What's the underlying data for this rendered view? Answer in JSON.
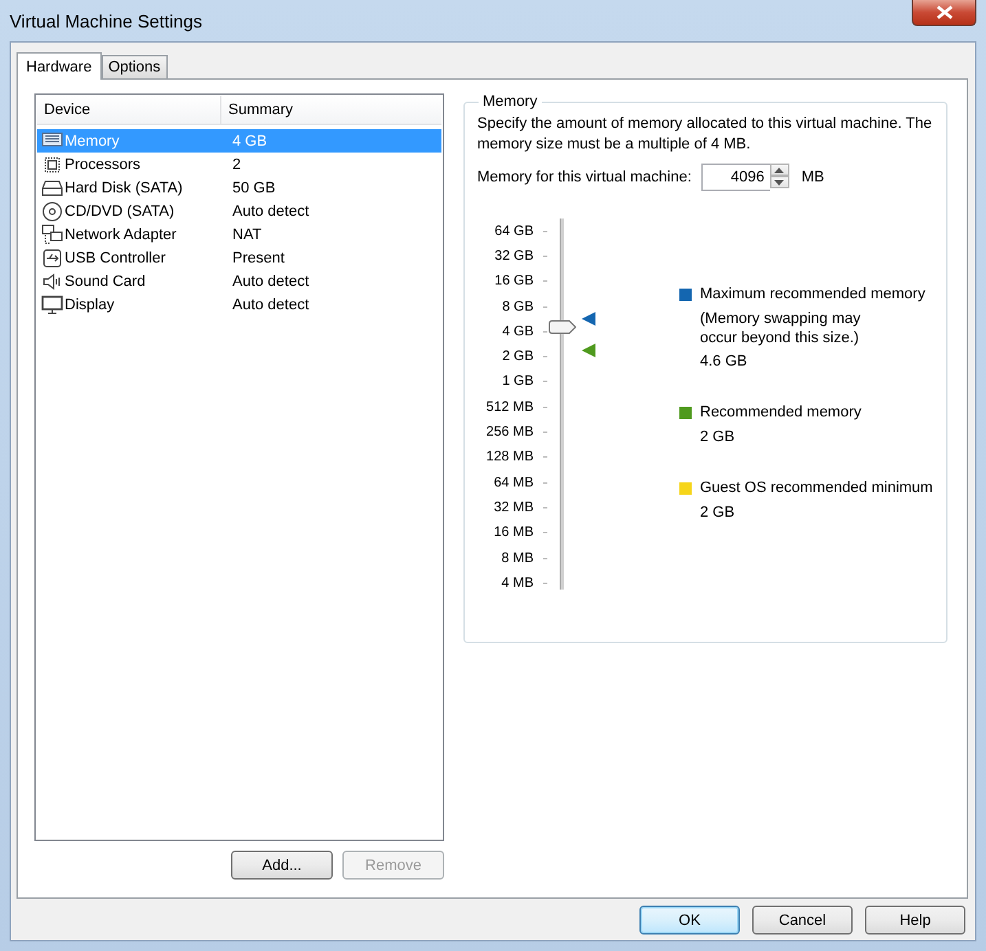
{
  "window": {
    "title": "Virtual Machine Settings"
  },
  "tabs": [
    {
      "label": "Hardware",
      "selected": true
    },
    {
      "label": "Options",
      "selected": false
    }
  ],
  "device_list": {
    "columns": [
      "Device",
      "Summary"
    ],
    "rows": [
      {
        "device": "Memory",
        "summary": "4 GB",
        "selected": true
      },
      {
        "device": "Processors",
        "summary": "2",
        "selected": false
      },
      {
        "device": "Hard Disk (SATA)",
        "summary": "50 GB",
        "selected": false
      },
      {
        "device": "CD/DVD (SATA)",
        "summary": "Auto detect",
        "selected": false
      },
      {
        "device": "Network Adapter",
        "summary": "NAT",
        "selected": false
      },
      {
        "device": "USB Controller",
        "summary": "Present",
        "selected": false
      },
      {
        "device": "Sound Card",
        "summary": "Auto detect",
        "selected": false
      },
      {
        "device": "Display",
        "summary": "Auto detect",
        "selected": false
      }
    ]
  },
  "list_buttons": [
    {
      "label": "Add...",
      "disabled": false
    },
    {
      "label": "Remove",
      "disabled": true
    }
  ],
  "memory": {
    "title": "Memory",
    "description": "Specify the amount of memory allocated to this virtual machine. The memory size must be a multiple of 4 MB.",
    "field_label": "Memory for this virtual machine:",
    "value": "4096",
    "unit": "MB",
    "slider": {
      "ticks": [
        "64 GB",
        "32 GB",
        "16 GB",
        "8 GB",
        "4 GB",
        "2 GB",
        "1 GB",
        "512 MB",
        "256 MB",
        "128 MB",
        "64 MB",
        "32 MB",
        "16 MB",
        "8 MB",
        "4 MB"
      ],
      "level": 0.714,
      "markers": [
        {
          "color": "#1466b0",
          "level": 0.729
        },
        {
          "color": "#4f9a1e",
          "level": 0.643
        }
      ]
    },
    "legend": [
      {
        "label": "Maximum recommended memory",
        "note": "(Memory swapping may occur beyond this size.)",
        "value": "4.6 GB",
        "color": "#1466b0"
      },
      {
        "label": "Recommended memory",
        "value": "2 GB",
        "color": "#4f9a1e"
      },
      {
        "label": "Guest OS recommended minimum",
        "value": "2 GB",
        "color": "#f6d51a"
      }
    ]
  },
  "dialog_buttons": [
    {
      "label": "OK",
      "default": true
    },
    {
      "label": "Cancel",
      "default": false
    },
    {
      "label": "Help",
      "default": false
    }
  ]
}
